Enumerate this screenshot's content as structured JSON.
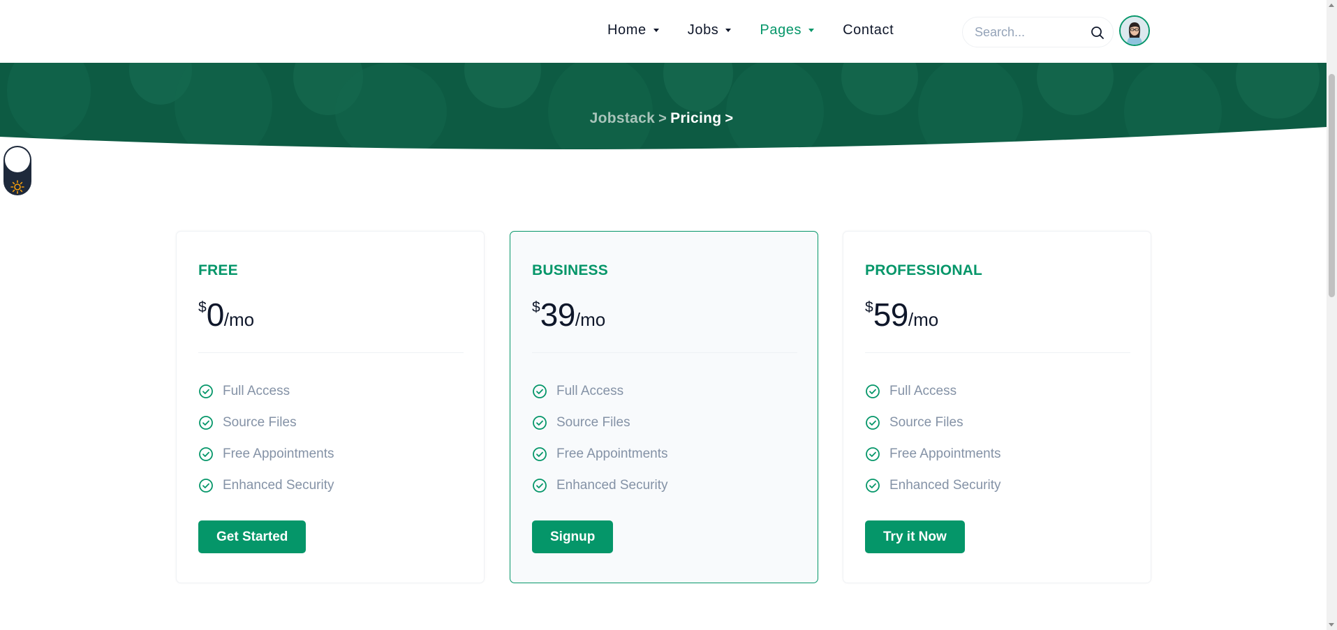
{
  "nav": {
    "items": [
      {
        "label": "Home",
        "dropdown": true,
        "active": false
      },
      {
        "label": "Jobs",
        "dropdown": true,
        "active": false
      },
      {
        "label": "Pages",
        "dropdown": true,
        "active": true
      },
      {
        "label": "Contact",
        "dropdown": false,
        "active": false
      }
    ],
    "search_placeholder": "Search...",
    "search_icon": "search-icon",
    "avatar_icon": "user-avatar"
  },
  "breadcrumb": {
    "items": [
      "Jobstack",
      "Pricing"
    ],
    "separator": ">"
  },
  "theme_toggle": {
    "icon": "sun-icon"
  },
  "plans": [
    {
      "name": "FREE",
      "currency": "$",
      "price": "0",
      "period": "/mo",
      "features": [
        "Full Access",
        "Source Files",
        "Free Appointments",
        "Enhanced Security"
      ],
      "button": "Get Started",
      "featured": false
    },
    {
      "name": "BUSINESS",
      "currency": "$",
      "price": "39",
      "period": "/mo",
      "features": [
        "Full Access",
        "Source Files",
        "Free Appointments",
        "Enhanced Security"
      ],
      "button": "Signup",
      "featured": true
    },
    {
      "name": "PROFESSIONAL",
      "currency": "$",
      "price": "59",
      "period": "/mo",
      "features": [
        "Full Access",
        "Source Files",
        "Free Appointments",
        "Enhanced Security"
      ],
      "button": "Try it Now",
      "featured": false
    }
  ],
  "colors": {
    "accent": "#059669",
    "hero_bg": "#0d5b43",
    "text_dark": "#0f172a",
    "text_muted": "#8492a6",
    "featured_bg": "#f8fafc"
  }
}
